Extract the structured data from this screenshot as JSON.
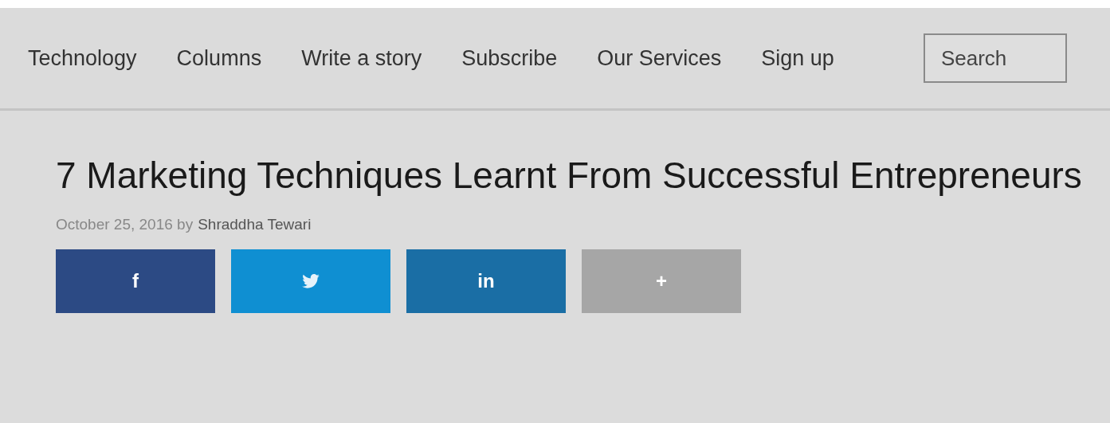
{
  "nav": {
    "items": [
      {
        "label": "Technology"
      },
      {
        "label": "Columns"
      },
      {
        "label": "Write a story"
      },
      {
        "label": "Subscribe"
      },
      {
        "label": "Our Services"
      },
      {
        "label": "Sign up"
      }
    ],
    "search": {
      "placeholder": "Search"
    }
  },
  "article": {
    "title": "7 Marketing Techniques Learnt From Successful Entrepreneurs",
    "date_byline": "October 25, 2016 by",
    "author": "Shraddha Tewari"
  },
  "share_buttons": [
    {
      "kind": "facebook",
      "label": "f",
      "color": "#2c4a84"
    },
    {
      "kind": "twitter",
      "color": "#0f8fd2"
    },
    {
      "kind": "linkedin",
      "label": "in",
      "color": "#1a6ea5"
    },
    {
      "kind": "more",
      "label": "+",
      "color": "#a6a6a6"
    }
  ]
}
